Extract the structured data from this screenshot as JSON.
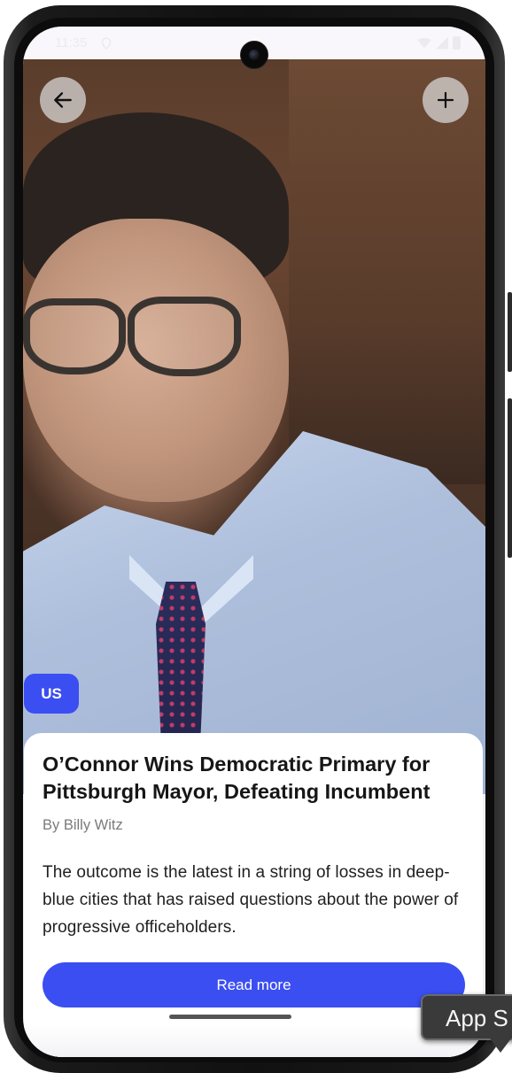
{
  "status_bar": {
    "time": "11:35",
    "icons": [
      "location-icon",
      "wifi-icon",
      "cellular-icon",
      "battery-icon"
    ]
  },
  "toolbar": {
    "back_icon": "arrow-left-icon",
    "add_icon": "plus-icon"
  },
  "article": {
    "section_badge": "US",
    "title": "O’Connor Wins Democratic Primary for Pittsburgh Mayor, Defeating Incumbent",
    "byline": "By Billy Witz",
    "summary": "The outcome is the latest in a string of losses in deep-blue cities that has raised questions about the power of progressive officeholders.",
    "read_more_label": "Read more"
  },
  "tooltip": {
    "text": "App S"
  },
  "colors": {
    "accent": "#3b4ef2",
    "card_background": "#ffffff",
    "title_text": "#161616",
    "byline_text": "#7b7b7b"
  }
}
